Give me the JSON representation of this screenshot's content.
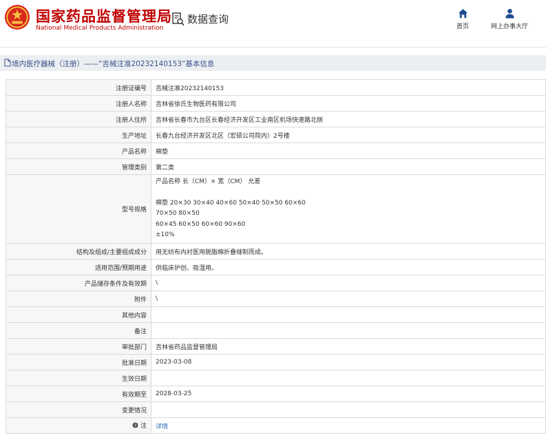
{
  "header": {
    "site_name_cn": "国家药品监督管理局",
    "site_name_en": "National Medical Products Administration",
    "query_label": "数据查询",
    "nav": [
      {
        "label": "首页",
        "icon": "home-icon"
      },
      {
        "label": "网上办事大厅",
        "icon": "user-icon"
      }
    ]
  },
  "breadcrumb": {
    "text": "境内医疗器械（注册）——“吉械注准20232140153”基本信息"
  },
  "table": {
    "rows": [
      {
        "key": "注册证编号",
        "value": "吉械注准20232140153"
      },
      {
        "key": "注册人名称",
        "value": "吉林省徐氏生物医药有限公司"
      },
      {
        "key": "注册人住所",
        "value": "吉林省长春市九台区长春经济开发区工业南区机场快速路北侧"
      },
      {
        "key": "生产地址",
        "value": "长春九台经济开发区北区（宏硕公司院内）2号楼"
      },
      {
        "key": "产品名称",
        "value": "棉垫"
      },
      {
        "key": "管理类别",
        "value": "第二类"
      },
      {
        "key": "型号规格",
        "lines": [
          "产品名称 长（CM）× 宽（CM） 允差",
          "",
          "棉垫 20×30 30×40 40×60 50×40 50×50 60×60",
          "70×50 80×50",
          "60×45 60×50 60×60 90×60",
          "±10%"
        ]
      },
      {
        "key": "结构及组成/主要组成成分",
        "value": "用无纺布内衬医用脱脂棉折叠缝制而成。"
      },
      {
        "key": "适用范围/预期用途",
        "value": "供临床护创、吸湿用。"
      },
      {
        "key": "产品储存条件及有效期",
        "value": "\\"
      },
      {
        "key": "附件",
        "value": "\\"
      },
      {
        "key": "其他内容",
        "value": ""
      },
      {
        "key": "备注",
        "value": ""
      },
      {
        "key": "审批部门",
        "value": "吉林省药品监督管理局"
      },
      {
        "key": "批准日期",
        "value": "2023-03-08"
      },
      {
        "key": "生效日期",
        "value": ""
      },
      {
        "key": "有效期至",
        "value": "2028-03-25"
      },
      {
        "key": "变更情况",
        "value": ""
      },
      {
        "key": "注",
        "value": "详情",
        "key_icon": "help-icon"
      }
    ]
  },
  "colors": {
    "brand": "#c00000",
    "link": "#2a6fb4",
    "breadcrumb_bg": "#eceff2",
    "breadcrumb_text": "#3a4f8a",
    "nav_icon": "#1e4b8f"
  }
}
